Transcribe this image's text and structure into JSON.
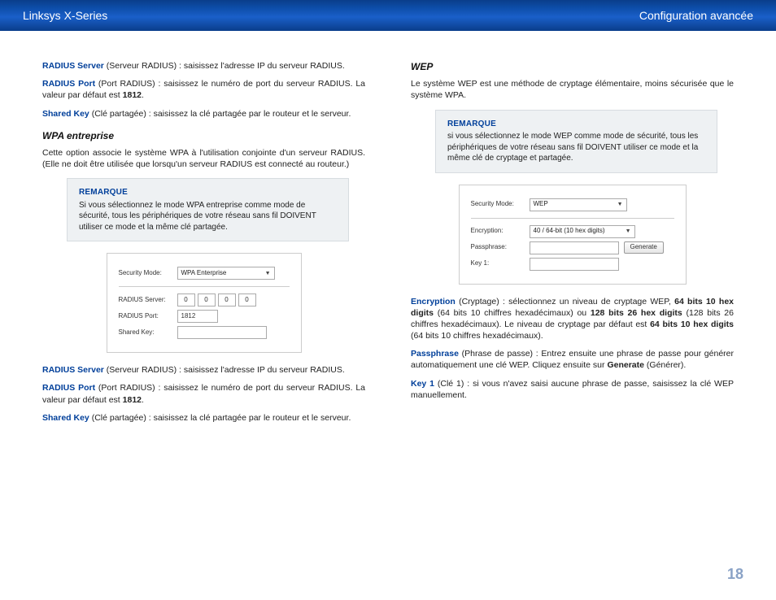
{
  "header": {
    "left": "Linksys X-Series",
    "right": "Configuration avancée"
  },
  "left": {
    "radius_server": {
      "term": "RADIUS Server",
      "text": "  (Serveur RADIUS) : saisissez l'adresse IP du serveur RADIUS."
    },
    "radius_port": {
      "term": "RADIUS Port",
      "text": " (Port RADIUS) : saisissez le numéro de port du serveur RADIUS. La valeur par défaut est ",
      "bold": "1812",
      "tail": "."
    },
    "shared_key": {
      "term": "Shared Key",
      "text": " (Clé partagée) : saisissez la clé partagée par le routeur et le serveur."
    },
    "wpa_title": "WPA entreprise",
    "wpa_intro": "Cette option associe le système WPA à l'utilisation conjointe d'un serveur RADIUS. (Elle ne doit être utilisée que lorsqu'un serveur RADIUS est connecté au routeur.)",
    "note": {
      "title": "REMARQUE",
      "body": "Si vous sélectionnez le mode WPA entreprise comme mode de sécurité, tous les périphériques de votre réseau sans fil DOIVENT utiliser ce mode et la même clé partagée."
    },
    "figureA": {
      "security_label": "Security Mode:",
      "security_value": "WPA Enterprise",
      "radius_server_label": "RADIUS Server:",
      "ip": [
        "0",
        "0",
        "0",
        "0"
      ],
      "radius_port_label": "RADIUS Port:",
      "radius_port_value": "1812",
      "shared_key_label": "Shared Key:"
    },
    "radius_server2": {
      "term": "RADIUS Server",
      "text": "  (Serveur RADIUS) : saisissez l'adresse IP du serveur RADIUS."
    },
    "radius_port2": {
      "term": "RADIUS Port",
      "text": " (Port RADIUS) : saisissez le numéro de port du serveur RADIUS. La valeur par défaut est ",
      "bold": "1812",
      "tail": "."
    },
    "shared_key2": {
      "term": "Shared Key",
      "text": " (Clé partagée) : saisissez la clé partagée par le routeur et le serveur."
    }
  },
  "right": {
    "wep_title": "WEP",
    "wep_intro": "Le système WEP est une méthode de cryptage élémentaire, moins sécurisée que le système WPA.",
    "note": {
      "title": "REMARQUE",
      "body": "si vous sélectionnez le mode WEP comme mode de sécurité, tous les périphériques de votre réseau sans fil DOIVENT utiliser ce mode et la même clé de cryptage et partagée."
    },
    "figureB": {
      "security_label": "Security Mode:",
      "security_value": "WEP",
      "encryption_label": "Encryption:",
      "encryption_value": "40 / 64-bit (10 hex digits)",
      "passphrase_label": "Passphrase:",
      "generate": "Generate",
      "key1_label": "Key 1:"
    },
    "encryption": {
      "term": "Encryption",
      "text": " (Cryptage) : sélectionnez un niveau de cryptage WEP, ",
      "b1": "64 bits 10 hex digits",
      "mid1": " (64 bits 10 chiffres hexadécimaux) ou ",
      "b2": "128 bits 26 hex digits",
      "mid2": " (128 bits 26 chiffres hexadécimaux). Le niveau de cryptage par défaut est ",
      "b3": "64 bits 10 hex digits",
      "tail": " (64 bits 10 chiffres hexadécimaux)."
    },
    "passphrase": {
      "term": "Passphrase",
      "text": " (Phrase de passe) : Entrez ensuite une phrase de passe pour générer automatiquement une clé WEP. Cliquez ensuite sur ",
      "bold": "Generate",
      "tail": " (Générer)."
    },
    "key1": {
      "term": "Key 1",
      "text": "  (Clé 1) : si vous n'avez saisi aucune phrase de passe, saisissez la clé WEP manuellement."
    }
  },
  "page_number": "18"
}
